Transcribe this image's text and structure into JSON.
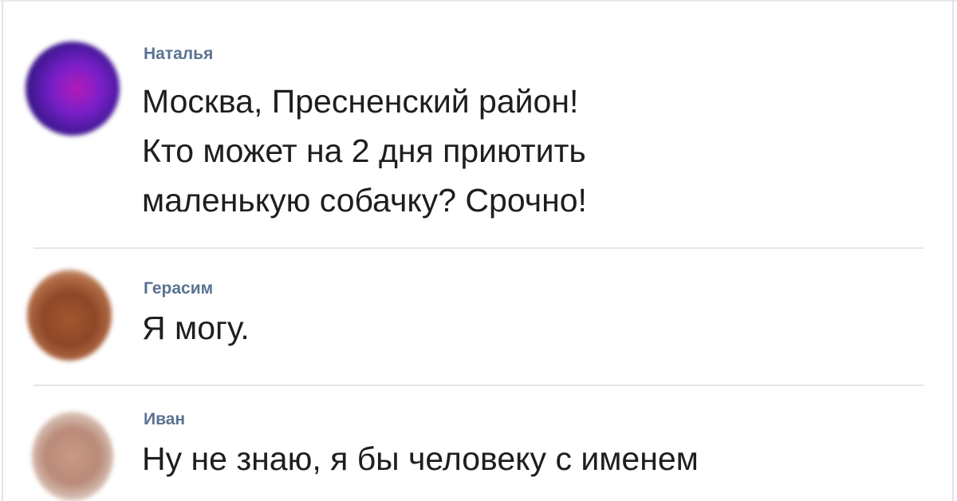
{
  "comments": [
    {
      "author": "Наталья",
      "lines": [
        "Москва, Пресненский район!",
        "Кто может на 2 дня приютить",
        "маленькую собачку? Срочно!"
      ]
    },
    {
      "author": "Герасим",
      "lines": [
        "Я могу."
      ]
    },
    {
      "author": "Иван",
      "lines": [
        "Ну не знаю, я бы человеку с именем"
      ]
    }
  ]
}
